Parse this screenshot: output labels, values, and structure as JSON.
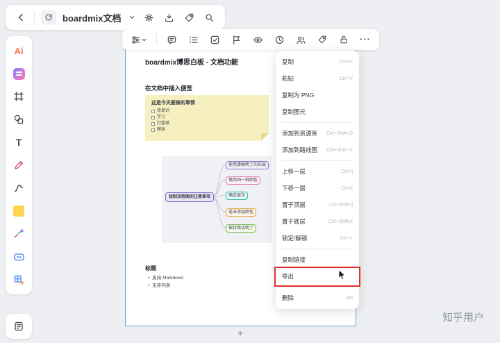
{
  "header": {
    "doc_title": "boardmix文档",
    "icons": [
      "back",
      "boardmix-logo",
      "chevron-down",
      "settings",
      "save",
      "tag",
      "search"
    ]
  },
  "sidebar": {
    "ai_label": "Ai",
    "text_tool_label": "T",
    "tools": [
      "ai-assistant",
      "templates",
      "frame",
      "shapes",
      "text",
      "pen",
      "connector",
      "sticky-note",
      "mind-map",
      "embed",
      "table"
    ],
    "bottom_tool": "notes"
  },
  "canvas_toolbar": {
    "icons": [
      "text-style",
      "comment",
      "ordered-list",
      "task",
      "flag",
      "eye",
      "history",
      "collaborators",
      "tag",
      "unlock",
      "more"
    ],
    "more_label": "···"
  },
  "document": {
    "title": "boardmix博思白板 - 文档功能",
    "section_insert_note": "在文档中插入便签",
    "sticky_note": {
      "title": "这是今天要做的事情",
      "tasks": [
        "背单词",
        "学习",
        "打篮球",
        "健身"
      ]
    },
    "mindmap": {
      "center": "绘制流程图的注意事项",
      "branches": [
        {
          "label": "使用清晰明了的布局",
          "color": "#8f76d6"
        },
        {
          "label": "慎用同一种颜色",
          "color": "#e57fab"
        },
        {
          "label": "确定层次",
          "color": "#35b5a9"
        },
        {
          "label": "适当添加颜色",
          "color": "#e8a23f"
        },
        {
          "label": "保持简洁明了",
          "color": "#7fb94f"
        }
      ]
    },
    "heading2": "标题",
    "bullets": [
      "支持 Markdown",
      "无序列表"
    ]
  },
  "context_menu": {
    "items": [
      {
        "label": "复制",
        "shortcut": "Ctrl+C"
      },
      {
        "label": "粘贴",
        "shortcut": "Ctrl+V"
      },
      {
        "label": "复制为 PNG",
        "shortcut": ""
      },
      {
        "label": "复制图元",
        "shortcut": ""
      },
      {
        "label": "添加到资源库",
        "shortcut": "Ctrl+Shift+D"
      },
      {
        "label": "添加到路线图",
        "shortcut": "Ctrl+Shift+X"
      },
      {
        "label": "上移一层",
        "shortcut": "Ctrl+]"
      },
      {
        "label": "下移一层",
        "shortcut": "Ctrl+["
      },
      {
        "label": "置于顶层",
        "shortcut": "Ctrl+Shift+]"
      },
      {
        "label": "置于底层",
        "shortcut": "Ctrl+Shift+["
      },
      {
        "label": "锁定/解锁",
        "shortcut": "Ctrl+L"
      },
      {
        "label": "复制链接",
        "shortcut": ""
      },
      {
        "label": "导出",
        "shortcut": "",
        "highlighted": true
      },
      {
        "label": "删除",
        "shortcut": "Del"
      }
    ]
  },
  "canvas": {
    "plus_label": "+"
  },
  "watermark": "知乎用户",
  "colors": {
    "selection_border": "#6aa1dc",
    "highlight_red": "#e0312e",
    "sticky_yellow": "#f6efbf",
    "background": "#edeff2"
  }
}
